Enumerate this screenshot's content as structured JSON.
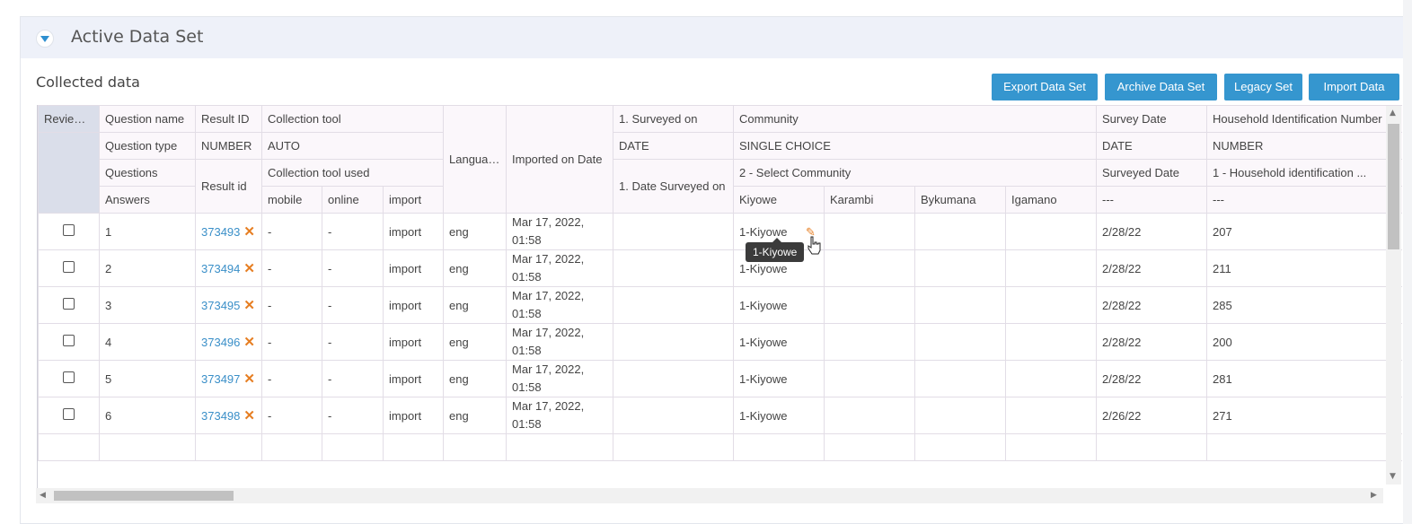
{
  "panel": {
    "title": "Active Data Set",
    "section_title": "Collected data"
  },
  "buttons": {
    "export": "Export Data Set",
    "archive": "Archive Data Set",
    "legacy": "Legacy Set",
    "import": "Import Data"
  },
  "header": {
    "reviewed": "Reviewed",
    "r1": {
      "label": "Question name",
      "result": "Result ID",
      "collection": "Collection tool",
      "language": "Language",
      "imported": "Imported on Date",
      "surveyed_on": "1. Surveyed on",
      "community": "Community",
      "survey_date": "Survey Date",
      "household": "Household Identification Number"
    },
    "r2": {
      "label": "Question type",
      "result": "NUMBER",
      "collection": "AUTO",
      "surveyed_on": "DATE",
      "community": "SINGLE CHOICE",
      "survey_date": "DATE",
      "household": "NUMBER"
    },
    "r3": {
      "label": "Questions",
      "result": "Result id",
      "collection": "Collection tool used",
      "surveyed_on": "1. Date Surveyed on",
      "community": "2 - Select Community",
      "survey_date": "Surveyed Date",
      "household": "1 - Household identification ..."
    },
    "r4": {
      "label": "Answers",
      "mobile": "mobile",
      "online": "online",
      "import": "import",
      "kiyowe": "Kiyowe",
      "karambi": "Karambi",
      "bykumana": "Bykumana",
      "igamano": "Igamano",
      "survey_date": "---",
      "household": "---"
    }
  },
  "rows": [
    {
      "n": "1",
      "id": "373493",
      "mobile": "-",
      "online": "-",
      "import": "import",
      "lang": "eng",
      "d1": "Mar 17, 2022,",
      "d2": "01:58",
      "community": "1-Kiyowe",
      "survey_date": "2/28/22",
      "household": "207"
    },
    {
      "n": "2",
      "id": "373494",
      "mobile": "-",
      "online": "-",
      "import": "import",
      "lang": "eng",
      "d1": "Mar 17, 2022,",
      "d2": "01:58",
      "community": "1-Kiyowe",
      "survey_date": "2/28/22",
      "household": "211"
    },
    {
      "n": "3",
      "id": "373495",
      "mobile": "-",
      "online": "-",
      "import": "import",
      "lang": "eng",
      "d1": "Mar 17, 2022,",
      "d2": "01:58",
      "community": "1-Kiyowe",
      "survey_date": "2/28/22",
      "household": "285"
    },
    {
      "n": "4",
      "id": "373496",
      "mobile": "-",
      "online": "-",
      "import": "import",
      "lang": "eng",
      "d1": "Mar 17, 2022,",
      "d2": "01:58",
      "community": "1-Kiyowe",
      "survey_date": "2/28/22",
      "household": "200"
    },
    {
      "n": "5",
      "id": "373497",
      "mobile": "-",
      "online": "-",
      "import": "import",
      "lang": "eng",
      "d1": "Mar 17, 2022,",
      "d2": "01:58",
      "community": "1-Kiyowe",
      "survey_date": "2/28/22",
      "household": "281"
    },
    {
      "n": "6",
      "id": "373498",
      "mobile": "-",
      "online": "-",
      "import": "import",
      "lang": "eng",
      "d1": "Mar 17, 2022,",
      "d2": "01:58",
      "community": "1-Kiyowe",
      "survey_date": "2/26/22",
      "household": "271"
    }
  ],
  "tooltip": "1-Kiyowe",
  "icons": {
    "remove": "close-x-icon",
    "edit": "pencil-icon",
    "cursor": "hand-pointer-icon"
  },
  "colors": {
    "accent": "#3596cf",
    "link": "#3a8fc8",
    "warn": "#e67e22"
  }
}
